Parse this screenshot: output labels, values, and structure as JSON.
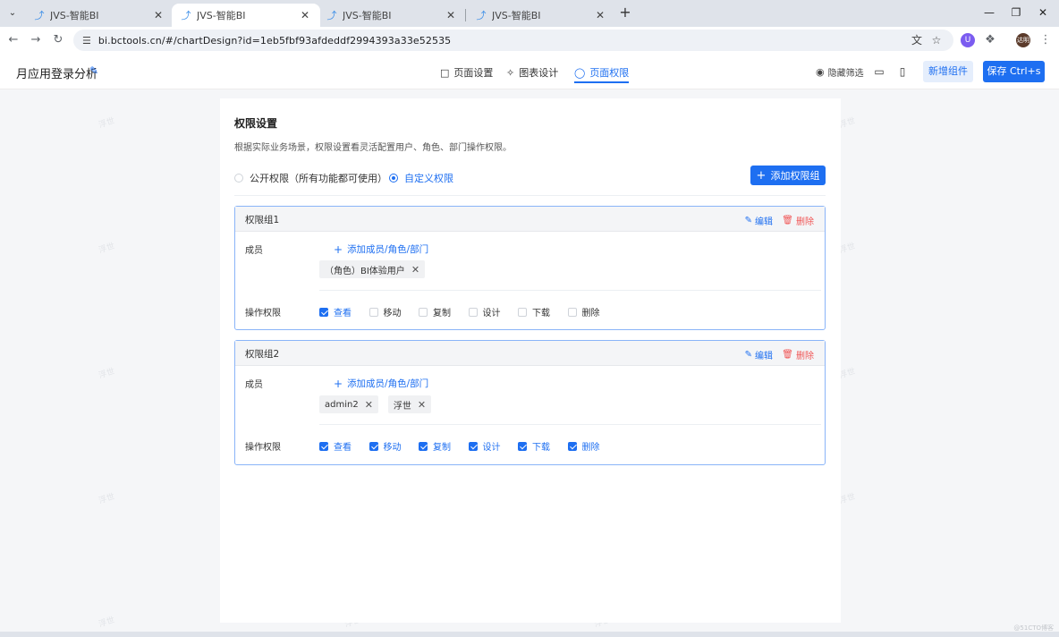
{
  "browser": {
    "tabs": [
      {
        "title": "JVS-智能BI",
        "active": false
      },
      {
        "title": "JVS-智能BI",
        "active": true
      },
      {
        "title": "JVS-智能BI",
        "active": false
      },
      {
        "title": "JVS-智能BI",
        "active": false
      }
    ],
    "url": "bi.bctools.cn/#/chartDesign?id=1eb5fbf93afdeddf2994393a33e52535",
    "profile_label": "达明"
  },
  "app": {
    "title": "月应用登录分析",
    "nav_tabs": [
      {
        "label": "页面设置",
        "icon": "bookmark-icon"
      },
      {
        "label": "图表设计",
        "icon": "chart-design-icon"
      },
      {
        "label": "页面权限",
        "icon": "shield-icon",
        "active": true
      }
    ],
    "hide_filter_label": "隐藏筛选",
    "add_component_label": "新增组件",
    "save_label": "保存 Ctrl+s"
  },
  "permissions": {
    "title": "权限设置",
    "description": "根据实际业务场景，权限设置看灵活配置用户、角色、部门操作权限。",
    "mode_options": [
      {
        "label": "公开权限（所有功能都可使用）",
        "selected": false
      },
      {
        "label": "自定义权限",
        "selected": true
      }
    ],
    "add_group_label": "添加权限组",
    "member_label": "成员",
    "operation_label": "操作权限",
    "add_member_label": "添加成员/角色/部门",
    "edit_label": "编辑",
    "delete_label": "删除",
    "groups": [
      {
        "name": "权限组1",
        "members": [
          "（角色）BI体验用户"
        ],
        "operations": [
          {
            "label": "查看",
            "checked": true
          },
          {
            "label": "移动",
            "checked": false
          },
          {
            "label": "复制",
            "checked": false
          },
          {
            "label": "设计",
            "checked": false
          },
          {
            "label": "下载",
            "checked": false
          },
          {
            "label": "删除",
            "checked": false
          }
        ]
      },
      {
        "name": "权限组2",
        "members": [
          "admin2",
          "浮世"
        ],
        "operations": [
          {
            "label": "查看",
            "checked": true
          },
          {
            "label": "移动",
            "checked": true
          },
          {
            "label": "复制",
            "checked": true
          },
          {
            "label": "设计",
            "checked": true
          },
          {
            "label": "下载",
            "checked": true
          },
          {
            "label": "删除",
            "checked": true
          }
        ]
      }
    ]
  },
  "watermark_text": "浮世",
  "corner_mark": "@51CTO博客",
  "colors": {
    "primary": "#1e6ff1",
    "danger": "#f05656",
    "group_border": "#8ab4f8"
  }
}
